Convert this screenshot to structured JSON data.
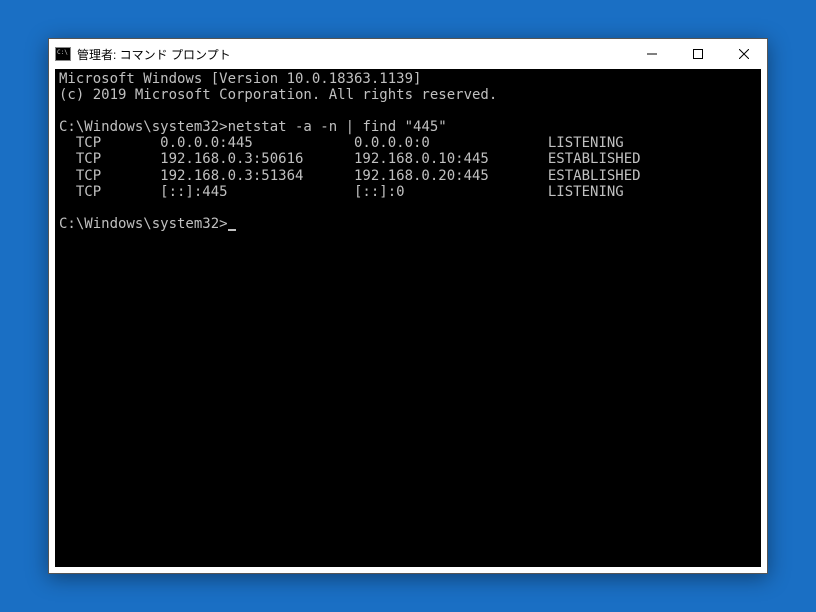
{
  "window": {
    "title": "管理者: コマンド プロンプト"
  },
  "terminal": {
    "banner_line1": "Microsoft Windows [Version 10.0.18363.1139]",
    "banner_line2": "(c) 2019 Microsoft Corporation. All rights reserved.",
    "prompt1": "C:\\Windows\\system32>",
    "command1": "netstat -a -n | find \"445\"",
    "rows": [
      {
        "proto": "TCP",
        "local": "0.0.0.0:445",
        "foreign": "0.0.0.0:0",
        "state": "LISTENING"
      },
      {
        "proto": "TCP",
        "local": "192.168.0.3:50616",
        "foreign": "192.168.0.10:445",
        "state": "ESTABLISHED"
      },
      {
        "proto": "TCP",
        "local": "192.168.0.3:51364",
        "foreign": "192.168.0.20:445",
        "state": "ESTABLISHED"
      },
      {
        "proto": "TCP",
        "local": "[::]:445",
        "foreign": "[::]:0",
        "state": "LISTENING"
      }
    ],
    "prompt2": "C:\\Windows\\system32>"
  }
}
